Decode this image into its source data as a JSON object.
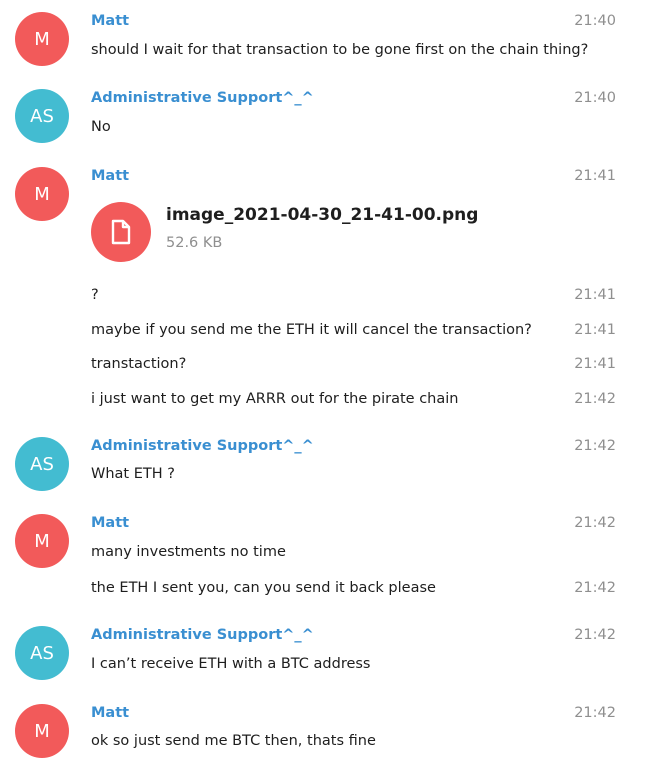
{
  "users": {
    "matt": {
      "name": "Matt",
      "initials": "M"
    },
    "admin": {
      "name": "Administrative Support^_^",
      "initials": "AS"
    }
  },
  "messages": [
    {
      "text": "should I wait for that transaction to be gone first on the chain thing?",
      "time": "21:40"
    },
    {
      "text": "No",
      "time": "21:40"
    },
    {
      "time": "21:41"
    },
    {
      "text": "?",
      "time": "21:41"
    },
    {
      "text": "maybe if you send me the ETH it will cancel the transaction?",
      "time": "21:41"
    },
    {
      "text": "transtaction?",
      "time": "21:41"
    },
    {
      "text": "i just want to get my ARRR out for the pirate chain",
      "time": "21:42"
    },
    {
      "text": "What ETH ?",
      "time": "21:42"
    },
    {
      "text": "many investments no time",
      "time": "21:42"
    },
    {
      "text": "the ETH I sent you, can you send it back please",
      "time": "21:42"
    },
    {
      "text": "I can’t receive ETH with a BTC address",
      "time": "21:42"
    },
    {
      "text": "ok so just send me BTC then, thats fine",
      "time": "21:42"
    }
  ],
  "file": {
    "name": "image_2021-04-30_21-41-00.png",
    "size": "52.6 KB",
    "icon": "document-icon"
  },
  "colors": {
    "matt_avatar": "#f25a5a",
    "admin_avatar": "#43bcd1",
    "name_text": "#3a8fd1",
    "time_text": "#8f8f8f"
  }
}
